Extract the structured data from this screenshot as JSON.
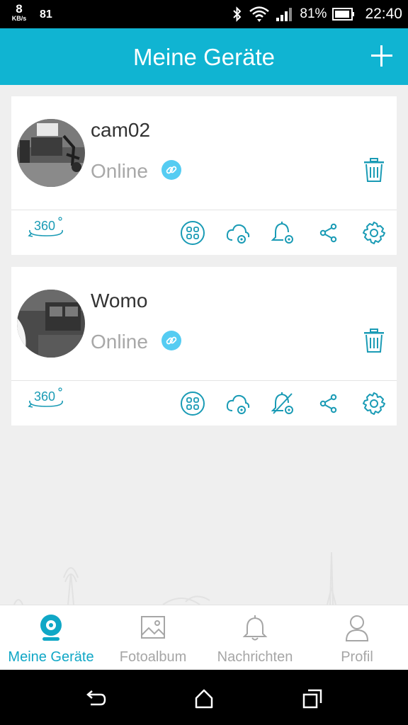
{
  "status_bar": {
    "speed_value": "8",
    "speed_unit": "KB/s",
    "notification_count": "81",
    "battery_percent": "81%",
    "time": "22:40"
  },
  "header": {
    "title": "Meine Geräte"
  },
  "devices": [
    {
      "name": "cam02",
      "status": "Online"
    },
    {
      "name": "Womo",
      "status": "Online"
    }
  ],
  "tabs": [
    {
      "label": "Meine Geräte",
      "icon": "camera-icon",
      "active": true
    },
    {
      "label": "Fotoalbum",
      "icon": "photo-icon",
      "active": false
    },
    {
      "label": "Nachrichten",
      "icon": "bell-icon",
      "active": false
    },
    {
      "label": "Profil",
      "icon": "person-icon",
      "active": false
    }
  ],
  "colors": {
    "accent": "#10b4d2",
    "icon_teal": "#1a9bb5",
    "link_badge": "#55ccf2",
    "status_gray": "#a8a8a8"
  }
}
